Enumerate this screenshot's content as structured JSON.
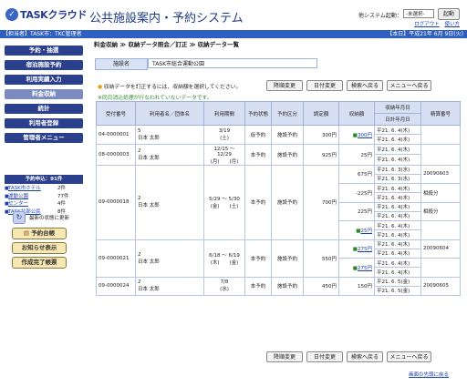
{
  "header": {
    "logo": "TASKクラウド",
    "title": "公共施設案内・予約システム",
    "system_label": "他システム起動：",
    "system_select": "-未選択-",
    "launch_button": "起動",
    "logout": "ログアウト",
    "help": "使い方"
  },
  "infobar": {
    "left": "【担当者】TASK市：TKC管理者",
    "right": "【本日】平成21年 6月 9日(火)"
  },
  "sidebar": {
    "menu": [
      "予約・抽選",
      "宿泊施設予約",
      "利用実績入力",
      "料金収納",
      "統計",
      "利用者登録",
      "管理者メニュー"
    ],
    "active_index": 3,
    "notice_title": "予約申込：91件",
    "notices": [
      {
        "name": "TASK市ホテル",
        "count": "2件"
      },
      {
        "name": "運動公園",
        "count": "77件"
      },
      {
        "name": "センター",
        "count": "4件"
      },
      {
        "name": "TASK北部公民",
        "count": "8件"
      }
    ],
    "refresh": "最新の状態に更新",
    "buttons": [
      "予約台帳",
      "お知らせ表示",
      "作成完了帳票"
    ]
  },
  "breadcrumb": "料金収納 ≫ 収納データ照会／訂正 ≫ 収納データ一覧",
  "facility": {
    "label": "施設名",
    "value": "TASK市総合運動公園"
  },
  "hint": "収納データを訂正するには、収納額を選択してください。",
  "warning": "※同日消込処理が行なわれていないデータです。",
  "actions": {
    "top": [
      "降順変更",
      "日付変更",
      "検索へ戻る",
      "メニューへ戻る"
    ],
    "bottom": [
      "降順変更",
      "日付変更",
      "検索へ戻る",
      "メニューへ戻る"
    ]
  },
  "table": {
    "headers": [
      "受付番号",
      "利用者名／団体名",
      "利用期間",
      "予約状態",
      "予約区分",
      "調定額",
      "収納額",
      "収納年月日",
      "日計年月日",
      "精算番号"
    ],
    "rows": [
      {
        "no": "04-0000001",
        "user1": "5",
        "user2": "日本 太郎",
        "period1": "3/19",
        "period2": "(土)",
        "status": "仮予約",
        "kind": "施設予約",
        "amount": "300円",
        "pays": [
          {
            "amt": "300円",
            "link": true,
            "d1": "平21. 6. 4(木)",
            "d2": "平21. 6. 4(木)",
            "settle": ""
          }
        ]
      },
      {
        "no": "08-0000003",
        "user1": "2",
        "user2": "日本 太郎",
        "period1": "12/15 ～ 12/29",
        "period2": "(月)　　(月)",
        "status": "本予約",
        "kind": "施設予約",
        "amount": "925円",
        "pays": [
          {
            "amt": "25円",
            "link": false,
            "d1": "平21. 6. 4(木)",
            "d2": "平21. 6. 4(木)",
            "settle": ""
          }
        ]
      },
      {
        "no": "09-0000018",
        "user1": "2",
        "user2": "日本 太郎",
        "period1": "5/29 ～ 5/30",
        "period2": "(金)　　(土)",
        "status": "本予約",
        "kind": "施設予約",
        "amount": "700円",
        "pays": [
          {
            "amt": "675円",
            "link": false,
            "d1": "平21. 6. 3(水)",
            "d2": "平21. 6. 3(水)",
            "settle": "20090603"
          },
          {
            "amt": "-225円",
            "link": false,
            "d1": "平21. 6. 4(木)",
            "d2": "平21. 6. 4(木)",
            "settle": "相殺分"
          },
          {
            "amt": "225円",
            "link": false,
            "d1": "平21. 6. 4(木)",
            "d2": "平21. 6. 4(木)",
            "settle": "相殺分"
          },
          {
            "amt": "25円",
            "link": true,
            "d1": "平21. 6. 4(木)",
            "d2": "平21. 6. 4(木)",
            "settle": ""
          }
        ]
      },
      {
        "no": "09-0000021",
        "user1": "2",
        "user2": "日本 太郎",
        "period1": "6/18 ～ 6/19",
        "period2": "(木)　　(金)",
        "status": "本予約",
        "kind": "施設予約",
        "amount": "550円",
        "pays": [
          {
            "amt": "275円",
            "link": true,
            "d1": "平21. 6. 4(木)",
            "d2": "平21. 6. 4(木)",
            "settle": "20090604"
          },
          {
            "amt": "275円",
            "link": true,
            "d1": "平21. 6. 4(木)",
            "d2": "平21. 6. 4(木)",
            "settle": ""
          }
        ]
      },
      {
        "no": "09-0000024",
        "user1": "2",
        "user2": "日本 太郎",
        "period1": "7/8",
        "period2": "(水)",
        "status": "本予約",
        "kind": "施設予約",
        "amount": "450円",
        "pays": [
          {
            "amt": "150円",
            "link": false,
            "d1": "平21. 6. 5(金)",
            "d2": "平21. 6. 5(金)",
            "settle": "20090605"
          }
        ]
      }
    ]
  },
  "to_top": "画面の先頭に戻る"
}
